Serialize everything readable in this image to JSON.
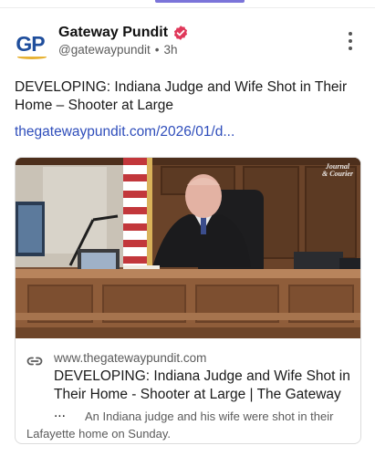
{
  "post": {
    "author": {
      "name": "Gateway Pundit",
      "handle": "@gatewaypundit",
      "time": "3h",
      "avatar_text": "GP",
      "verified": true
    },
    "text": "DEVELOPING: Indiana Judge and Wife Shot in Their Home – Shooter at Large",
    "link": "thegatewaypundit.com/2026/01/d...",
    "card": {
      "image_watermark_line1": "Journal",
      "image_watermark_line2": "& Courier",
      "domain": "www.thegatewaypundit.com",
      "title": "DEVELOPING: Indiana Judge and Wife Shot in Their Home - Shooter at Large | The Gateway ...",
      "description": "An Indiana judge and his wife were shot in their Lafayette home on Sunday."
    }
  },
  "icons": {
    "verified": "verified-badge-icon",
    "more": "more-vertical-icon",
    "link": "link-icon"
  },
  "colors": {
    "accent": "#7b74d9",
    "link": "#2e4dbb",
    "verified": "#e0385a",
    "brand_blue": "#1f4e9c",
    "brand_gold": "#e7b234"
  }
}
